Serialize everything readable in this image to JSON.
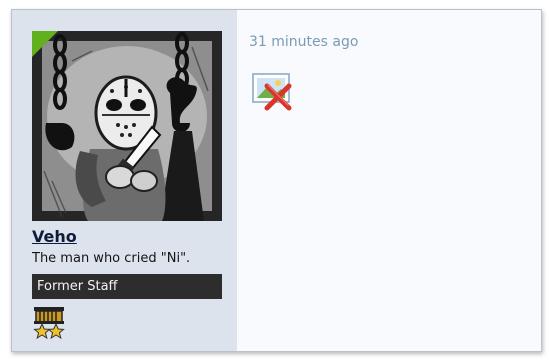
{
  "post": {
    "author": {
      "username": "Veho",
      "title": "The man who cried \"Ni\".",
      "banner": "Former Staff",
      "online": true,
      "avatar_icon": "avatar-image",
      "badge_icon": "staff-rank-badge-icon"
    },
    "timestamp": "31 minutes ago",
    "content": {
      "image_icon": "broken-image-icon"
    }
  },
  "colors": {
    "sidebar_bg": "#dde3ed",
    "content_bg": "#f8fafd",
    "banner_bg": "#2d2d2d",
    "online_marker": "#62b01e",
    "timestamp": "#7a9bb5"
  }
}
